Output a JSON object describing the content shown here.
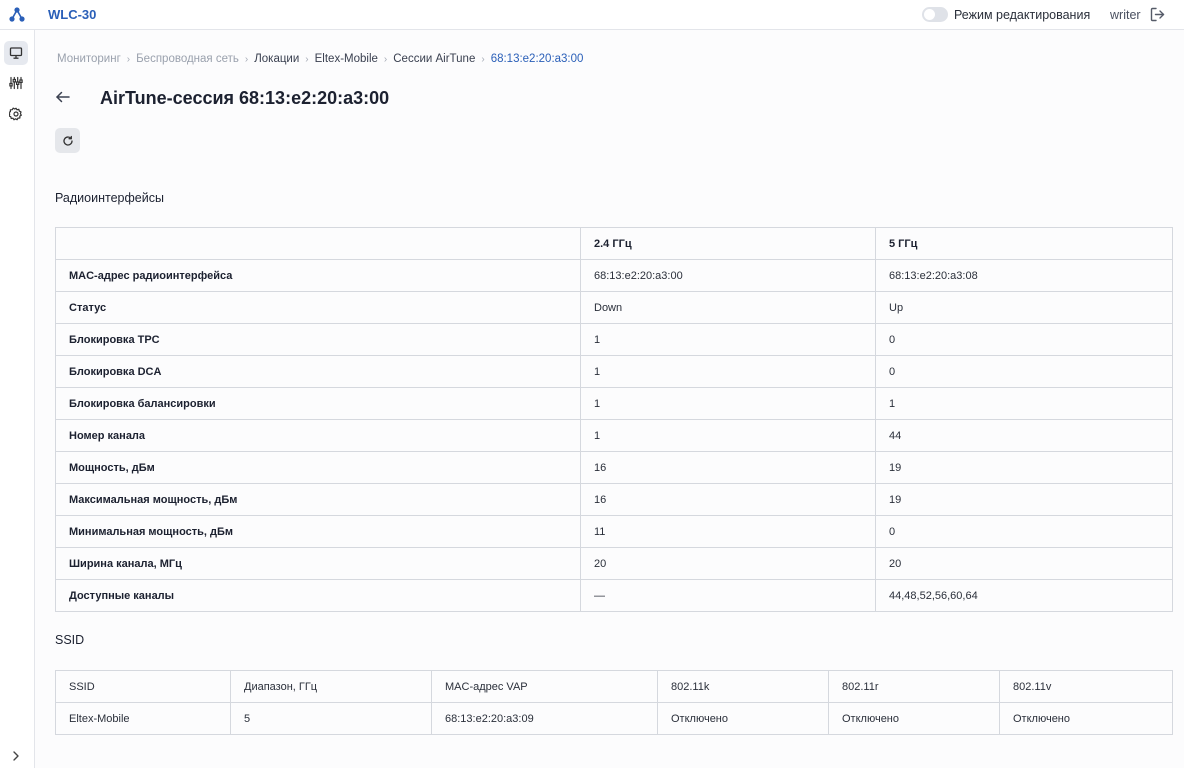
{
  "header": {
    "app_title": "WLC-30",
    "edit_mode_label": "Режим редактирования",
    "edit_mode_on": false,
    "user": "writer"
  },
  "sidebar": {
    "items": [
      {
        "icon": "monitor-icon",
        "active": true
      },
      {
        "icon": "equalizer-icon",
        "active": false
      },
      {
        "icon": "gear-icon",
        "active": false
      }
    ],
    "expand_icon": "chevron-right-icon"
  },
  "breadcrumb": [
    "Мониторинг",
    "Беспроводная сеть",
    "Локации",
    "Eltex-Mobile",
    "Сессии AirTune",
    "68:13:e2:20:a3:00"
  ],
  "page": {
    "title": "AirTune-сессия 68:13:e2:20:a3:00"
  },
  "radio_section": {
    "title": "Радиоинтерфейсы",
    "columns": [
      "",
      "2.4 ГГц",
      "5 ГГц"
    ],
    "rows": [
      [
        "MAC-адрес радиоинтерфейса",
        "68:13:e2:20:a3:00",
        "68:13:e2:20:a3:08"
      ],
      [
        "Статус",
        "Down",
        "Up"
      ],
      [
        "Блокировка TPC",
        "1",
        "0"
      ],
      [
        "Блокировка DCA",
        "1",
        "0"
      ],
      [
        "Блокировка балансировки",
        "1",
        "1"
      ],
      [
        "Номер канала",
        "1",
        "44"
      ],
      [
        "Мощность, дБм",
        "16",
        "19"
      ],
      [
        "Максимальная мощность, дБм",
        "16",
        "19"
      ],
      [
        "Минимальная мощность, дБм",
        "11",
        "0"
      ],
      [
        "Ширина канала, МГц",
        "20",
        "20"
      ],
      [
        "Доступные каналы",
        "—",
        "44,48,52,56,60,64"
      ]
    ]
  },
  "ssid_section": {
    "title": "SSID",
    "columns": [
      "SSID",
      "Диапазон, ГГц",
      "MAC-адрес VAP",
      "802.11k",
      "802.11r",
      "802.11v"
    ],
    "rows": [
      [
        "Eltex-Mobile",
        "5",
        "68:13:e2:20:a3:09",
        "Отключено",
        "Отключено",
        "Отключено"
      ]
    ]
  }
}
